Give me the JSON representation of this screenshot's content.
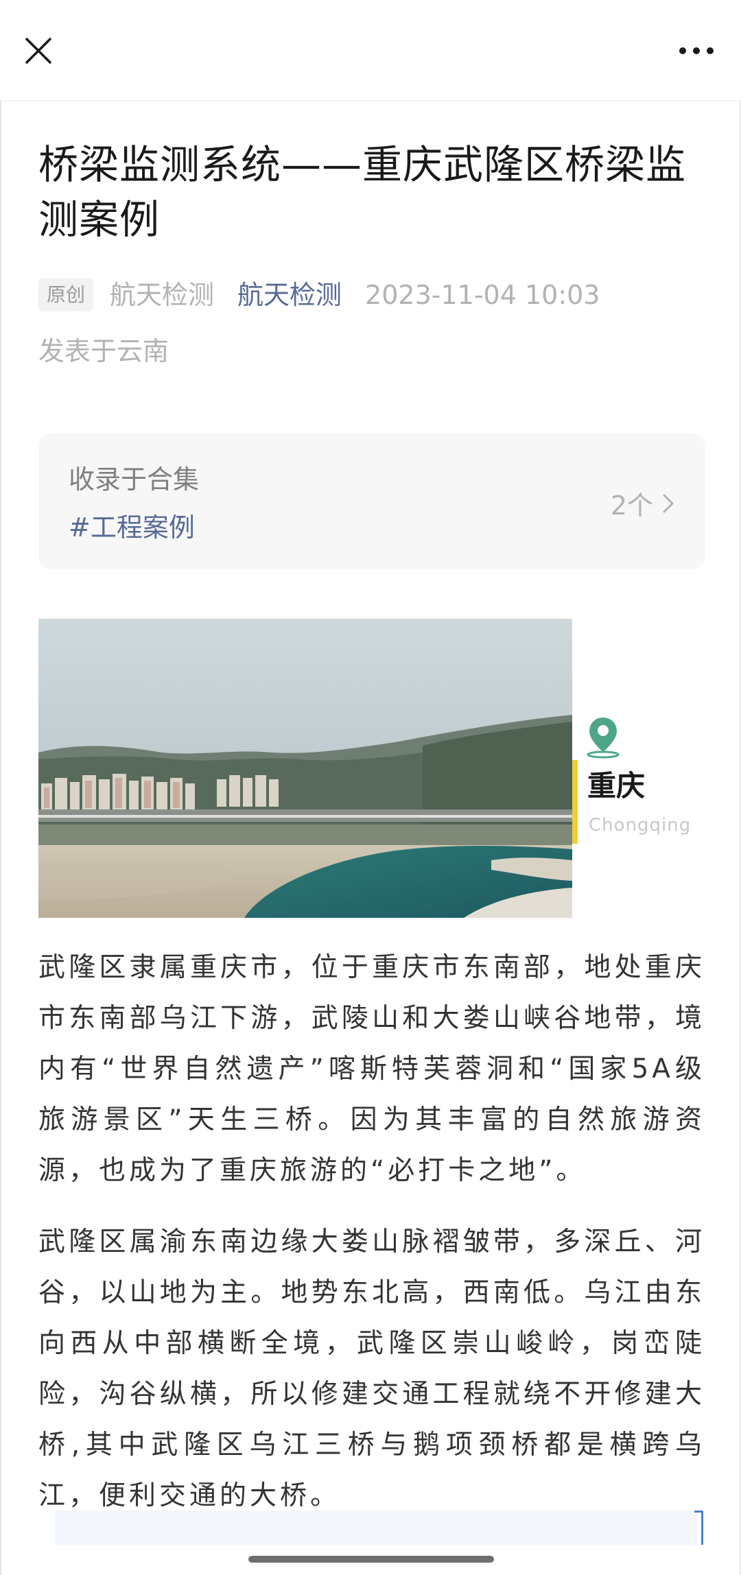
{
  "topbar": {
    "close_icon": "close-icon",
    "more_icon": "more-dots-icon"
  },
  "article": {
    "title": "桥梁监测系统——重庆武隆区桥梁监测案例",
    "original_badge": "原创",
    "author": "航天检测",
    "account": "航天检测",
    "date": "2023-11-04 10:03",
    "location": "发表于云南"
  },
  "collection": {
    "label": "收录于合集",
    "tag": "#工程案例",
    "count": "2个",
    "arrow_icon": "chevron-right-icon"
  },
  "hero": {
    "place_cn": "重庆",
    "place_en": "Chongqing",
    "pin_icon": "location-pin-icon",
    "accent_color": "#f0cf34",
    "pin_color": "#4fa58a"
  },
  "paragraphs": {
    "p1": "武隆区隶属重庆市，位于重庆市东南部，地处重庆市东南部乌江下游，武陵山和大娄山峡谷地带，境内有“世界自然遗产”喀斯特芙蓉洞和“国家5A级旅游景区”天生三桥。因为其丰富的自然旅游资源，也成为了重庆旅游的“必打卡之地”。",
    "p2": "武隆区属渝东南边缘大娄山脉褶皱带，多深丘、河谷，以山地为主。地势东北高，西南低。乌江由东向西从中部横断全境，武隆区崇山峻岭，岗峦陡险，沟谷纵横，所以修建交通工程就绕不开修建大桥,其中武隆区乌江三桥与鹅项颈桥都是横跨乌江，便利交通的大桥。"
  },
  "colors": {
    "link": "#576b95",
    "meta_gray": "#b2b2b2",
    "card_bg": "#f7f7f7"
  }
}
